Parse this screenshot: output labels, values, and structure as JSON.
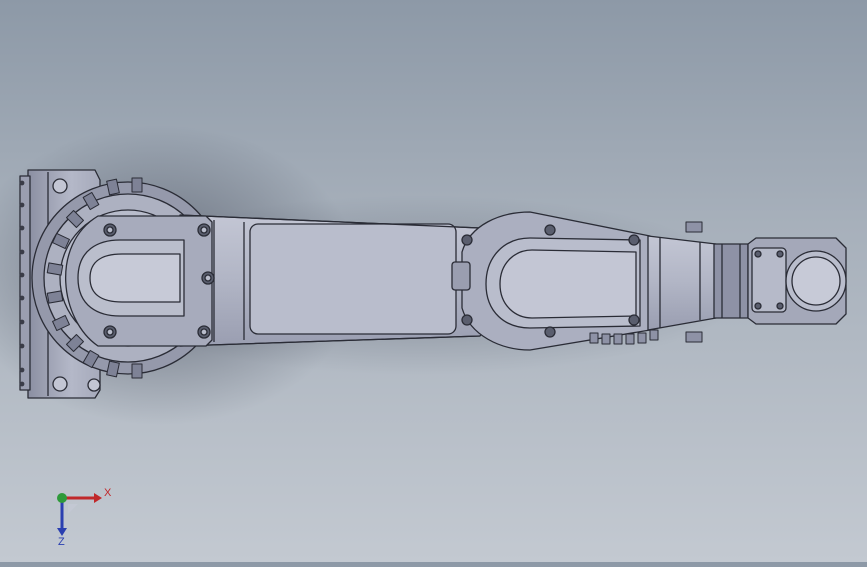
{
  "viewport": {
    "colors": {
      "background_top": "#8d99a7",
      "background_bottom": "#c3c9d1",
      "part_fill": "#b4b8c8",
      "part_shade": "#8e92a6",
      "edge": "#2a2c36"
    }
  },
  "triad": {
    "x_label": "X",
    "z_label": "Z",
    "x_color": "#c0282a",
    "y_color": "#2e9a3a",
    "z_color": "#2a3fb0"
  }
}
